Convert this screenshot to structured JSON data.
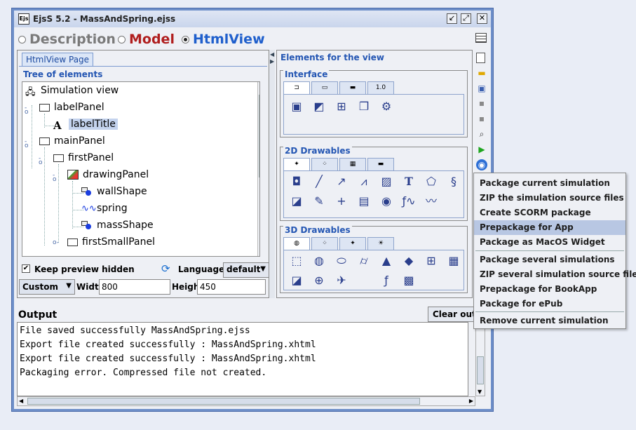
{
  "window": {
    "title": "EjsS 5.2 - MassAndSpring.ejss",
    "icon_text": "Ejs"
  },
  "modes": [
    {
      "label": "Description",
      "selected": false,
      "color": "#7a7a7a"
    },
    {
      "label": "Model",
      "selected": false,
      "color": "#b01e1e"
    },
    {
      "label": "HtmlView",
      "selected": true,
      "color": "#1f5fcc"
    }
  ],
  "left": {
    "tab_label": "HtmlView Page",
    "tree_title": "Tree of elements",
    "tree": [
      {
        "label": "Simulation view",
        "icon": "tree-structure-icon"
      },
      {
        "label": "labelPanel",
        "icon": "panel-icon"
      },
      {
        "label": "labelTitle",
        "icon": "text-label-icon",
        "selected": true
      },
      {
        "label": "mainPanel",
        "icon": "panel-icon"
      },
      {
        "label": "firstPanel",
        "icon": "panel-icon"
      },
      {
        "label": "drawingPanel",
        "icon": "drawing-panel-icon"
      },
      {
        "label": "wallShape",
        "icon": "shape-icon"
      },
      {
        "label": "spring",
        "icon": "spring-icon"
      },
      {
        "label": "massShape",
        "icon": "shape-icon"
      },
      {
        "label": "firstSmallPanel",
        "icon": "panel-icon"
      }
    ],
    "keep_preview": {
      "label": "Keep preview hidden",
      "checked": true
    },
    "language": {
      "label": "Language:",
      "value": "default"
    },
    "size": {
      "preset": "Custom",
      "width_label": "Width",
      "width": "800",
      "height_label": "Height",
      "height": "450"
    }
  },
  "right": {
    "title": "Elements for the view",
    "groups": [
      {
        "label": "Interface",
        "tabs": [
          "",
          "",
          "",
          "1.0"
        ]
      },
      {
        "label": "2D Drawables",
        "tabs": [
          "",
          "",
          "",
          ""
        ]
      },
      {
        "label": "3D Drawables",
        "tabs": [
          "",
          "",
          "",
          ""
        ]
      }
    ],
    "text_element_glyph": "T"
  },
  "output": {
    "label": "Output",
    "clear_button": "Clear output",
    "lines": [
      "File saved successfully MassAndSpring.ejss",
      "Export file created successfully : MassAndSpring.xhtml",
      "Export file created successfully : MassAndSpring.xhtml",
      "Packaging error. Compressed file not created."
    ]
  },
  "menu": {
    "items": [
      "Package current simulation",
      "ZIP the simulation source files",
      "Create SCORM package",
      "Prepackage for App",
      "Package as MacOS Widget",
      "Package several simulations",
      "ZIP several simulation source files",
      "Prepackage for BookApp",
      "Package for ePub",
      "Remove current simulation"
    ],
    "highlighted_index": 3
  }
}
